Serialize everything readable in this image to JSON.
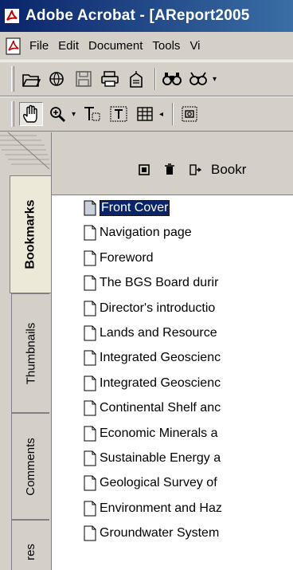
{
  "window": {
    "title": "Adobe Acrobat - [AReport2005"
  },
  "menu": {
    "items": [
      {
        "label": "File"
      },
      {
        "label": "Edit"
      },
      {
        "label": "Document"
      },
      {
        "label": "Tools"
      },
      {
        "label": "Vi"
      }
    ]
  },
  "toolbar1": {
    "icons": [
      "open-icon",
      "web-open-icon",
      "save-icon",
      "print-icon",
      "email-icon",
      "search-icon",
      "search-web-icon"
    ]
  },
  "toolbar2": {
    "icons": [
      "hand-tool-icon",
      "zoom-tool-icon",
      "text-select-icon",
      "column-select-icon",
      "table-select-icon",
      "snapshot-icon"
    ]
  },
  "nav_tabs": [
    {
      "label": "Bookmarks",
      "active": true
    },
    {
      "label": "Thumbnails",
      "active": false
    },
    {
      "label": "Comments",
      "active": false
    },
    {
      "label": "res",
      "active": false
    }
  ],
  "bookmarks_panel": {
    "title": "Bookr",
    "tools": [
      "new-bookmark-icon",
      "delete-bookmark-icon",
      "expand-bookmark-icon"
    ],
    "items": [
      {
        "label": "Front Cover",
        "selected": true
      },
      {
        "label": "Navigation page"
      },
      {
        "label": "Foreword"
      },
      {
        "label": "The BGS Board durir"
      },
      {
        "label": "Director's introductio"
      },
      {
        "label": "Lands and Resource"
      },
      {
        "label": "Integrated Geoscienc"
      },
      {
        "label": "Integrated Geoscienc"
      },
      {
        "label": "Continental Shelf anc"
      },
      {
        "label": "Economic Minerals a"
      },
      {
        "label": "Sustainable Energy a"
      },
      {
        "label": "Geological Survey of"
      },
      {
        "label": "Environment and Haz"
      },
      {
        "label": "Groundwater System"
      }
    ]
  }
}
